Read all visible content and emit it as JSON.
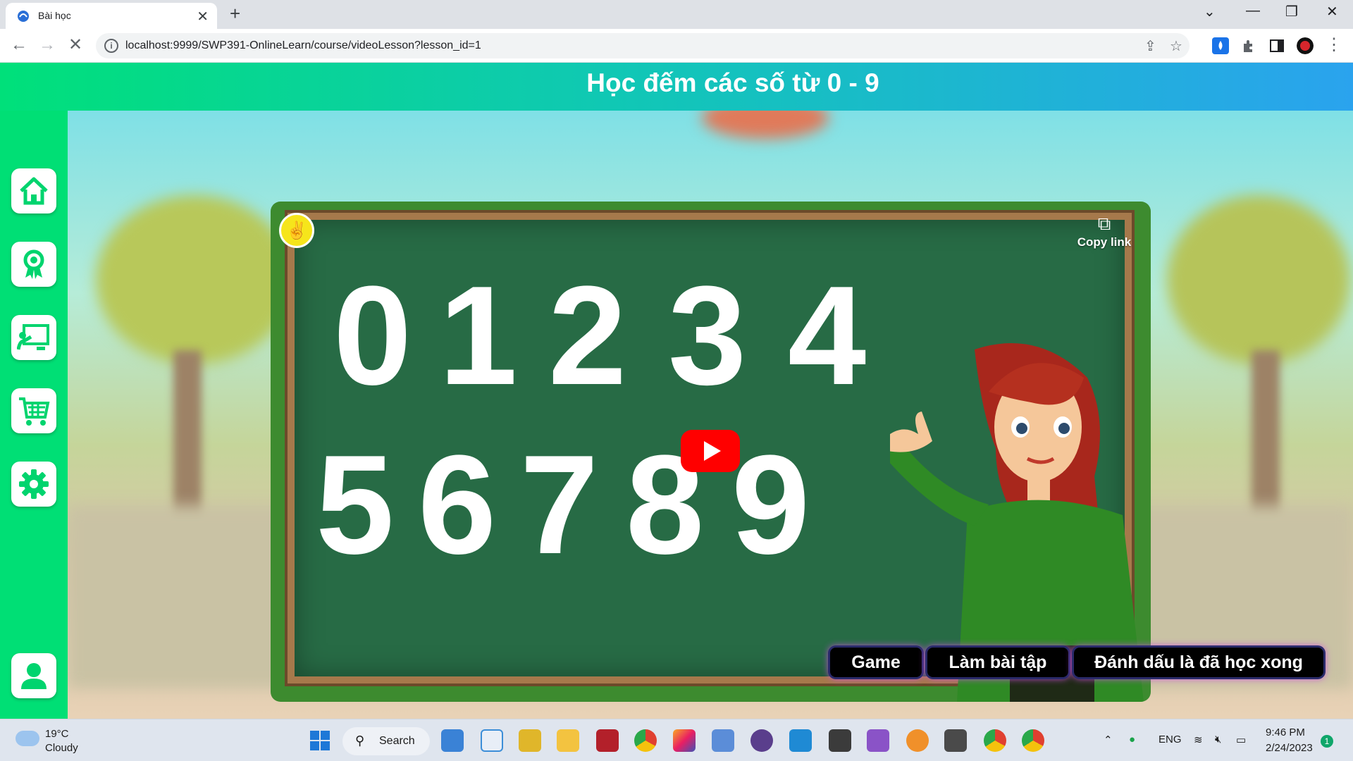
{
  "browser": {
    "tab_title": "Bài học",
    "url": "localhost:9999/SWP391-OnlineLearn/course/videoLesson?lesson_id=1",
    "tab_close": "✕",
    "new_tab": "+"
  },
  "lesson": {
    "title": "Học đếm các số từ 0 - 9"
  },
  "sidebar": {
    "items": [
      {
        "name": "home",
        "icon": "home-icon"
      },
      {
        "name": "achievements",
        "icon": "award-ribbon-icon"
      },
      {
        "name": "classroom",
        "icon": "presentation-board-icon"
      },
      {
        "name": "cart",
        "icon": "shopping-cart-icon"
      },
      {
        "name": "settings",
        "icon": "gear-icon"
      },
      {
        "name": "profile",
        "icon": "user-icon"
      }
    ]
  },
  "video": {
    "digits_top": [
      "0",
      "1",
      "2",
      "3",
      "4"
    ],
    "digits_bottom": [
      "5",
      "6",
      "7",
      "8",
      "9"
    ],
    "copy_link_label": "Copy link"
  },
  "actions": {
    "game": "Game",
    "exercise": "Làm bài tập",
    "mark_done": "Đánh dấu là đã học xong"
  },
  "taskbar": {
    "weather_temp": "19°C",
    "weather_desc": "Cloudy",
    "search_label": "Search",
    "language": "ENG",
    "time": "9:46 PM",
    "date": "2/24/2023",
    "notification_count": "1"
  },
  "colors": {
    "sidebar": "#00df75",
    "header_start": "#00e07a",
    "header_end": "#2aa3ee",
    "board": "#276b45",
    "youtube_red": "#ff0000"
  }
}
